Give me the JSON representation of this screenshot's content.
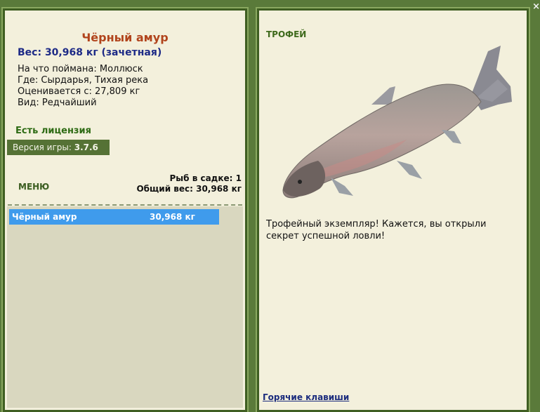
{
  "fish": {
    "name": "Чёрный амур",
    "weight_line": "Вес: 30,968 кг (зачетная)",
    "bait": "На что поймана: Моллюск",
    "location": "Где: Сырдарья, Тихая река",
    "value": "Оценивается с: 27,809 кг",
    "rarity": "Вид: Редчайший"
  },
  "license": "Есть лицензия",
  "version": {
    "label": "Версия игры: ",
    "number": "3.7.6"
  },
  "menu_label": "МЕНЮ",
  "keepnet": {
    "count": "Рыб в садке: 1",
    "total": "Общий вес: 30,968 кг"
  },
  "catch_list": [
    {
      "name": "Чёрный амур",
      "weight": "30,968 кг"
    }
  ],
  "trophy": {
    "title": "ТРОФЕЙ",
    "text": "Трофейный экземпляр! Кажется, вы открыли секрет успешной ловли!"
  },
  "hotkeys_link": "Горячие клавиши",
  "close_icon": "close-icon",
  "colors": {
    "frame": "#5a7a3a",
    "panel_bg": "#f3f0dc",
    "fish_name": "#b1441c",
    "weight": "#1d2a86",
    "selection": "#3f9bec",
    "license": "#2e6b14"
  }
}
